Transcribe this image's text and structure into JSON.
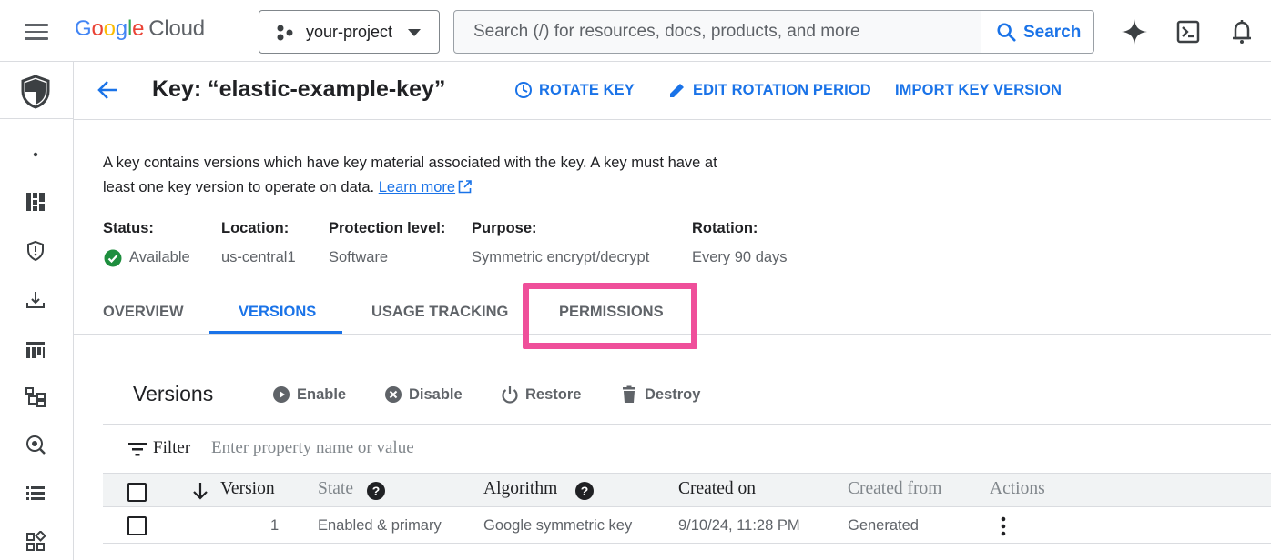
{
  "header": {
    "logo_google": [
      "G",
      "o",
      "o",
      "g",
      "l",
      "e"
    ],
    "logo_cloud": "Cloud",
    "project_name": "your-project",
    "search_placeholder": "Search (/) for resources, docs, products, and more",
    "search_button": "Search"
  },
  "page": {
    "title": "Key: “elastic-example-key”",
    "actions": {
      "rotate": "ROTATE KEY",
      "edit_rotation": "EDIT ROTATION PERIOD",
      "import_version": "IMPORT KEY VERSION"
    },
    "description": "A key contains versions which have key material associated with the key. A key must have at least one key version to operate on data.",
    "learn_more": "Learn more"
  },
  "properties": {
    "status_label": "Status:",
    "status_value": "Available",
    "location_label": "Location:",
    "location_value": "us-central1",
    "protection_label": "Protection level:",
    "protection_value": "Software",
    "purpose_label": "Purpose:",
    "purpose_value": "Symmetric encrypt/decrypt",
    "rotation_label": "Rotation:",
    "rotation_value": "Every 90 days"
  },
  "tabs": [
    "OVERVIEW",
    "VERSIONS",
    "USAGE TRACKING",
    "PERMISSIONS"
  ],
  "active_tab": "VERSIONS",
  "highlighted_tab": "PERMISSIONS",
  "versions": {
    "title": "Versions",
    "toolbar": {
      "enable": "Enable",
      "disable": "Disable",
      "restore": "Restore",
      "destroy": "Destroy"
    },
    "filter_label": "Filter",
    "filter_placeholder": "Enter property name or value",
    "columns": [
      "Version",
      "State",
      "Algorithm",
      "Created on",
      "Created from",
      "Actions"
    ],
    "rows": [
      {
        "version": "1",
        "state": "Enabled & primary",
        "algorithm": "Google symmetric key",
        "created_on": "9/10/24, 11:28 PM",
        "created_from": "Generated"
      }
    ]
  },
  "colors": {
    "accent": "#1a73e8",
    "highlight": "#ef4f9a",
    "status_ok": "#1e8e3e",
    "text_secondary": "#5f6368"
  },
  "icons": [
    "menu-icon",
    "project-icon",
    "search-icon",
    "gemini-spark-icon",
    "cloud-shell-icon",
    "notifications-icon",
    "security-shield-icon",
    "dashboard-icon",
    "shield-icon",
    "download-icon",
    "analytics-icon",
    "hierarchy-icon",
    "scan-icon",
    "list-icon",
    "apps-icon",
    "back-arrow-icon",
    "clock-icon",
    "pencil-icon",
    "check-circle-icon",
    "external-link-icon",
    "play-icon",
    "x-circle-icon",
    "power-icon",
    "trash-icon",
    "filter-icon",
    "sort-down-icon",
    "help-icon",
    "more-vert-icon"
  ]
}
